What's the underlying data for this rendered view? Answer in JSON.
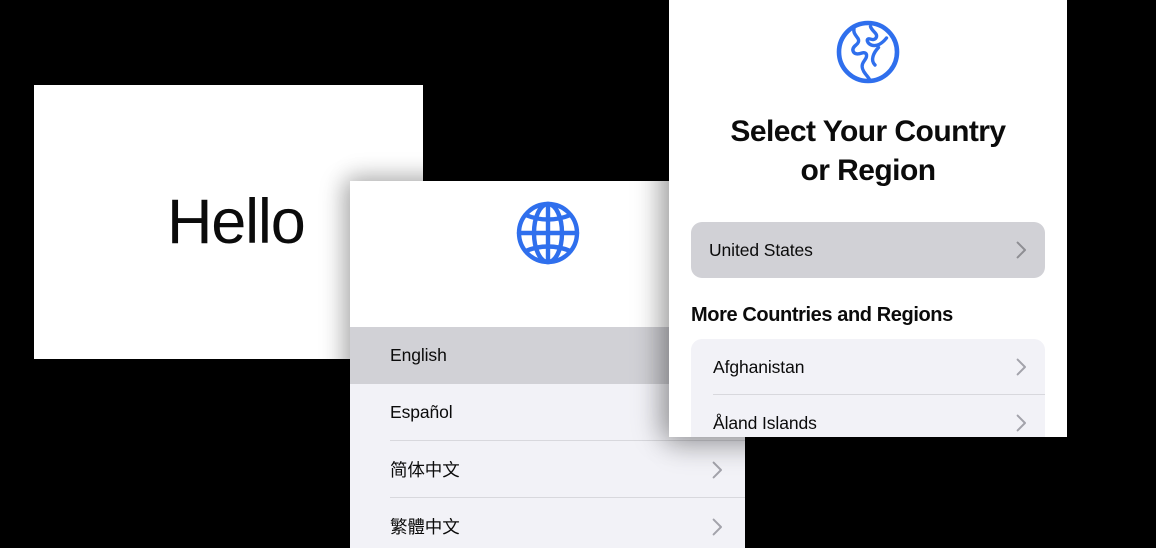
{
  "background_color": "#000000",
  "accent_color": "#2f6fed",
  "panels": {
    "hello": {
      "name": "welcome-panel",
      "greeting": "Hello"
    },
    "language": {
      "name": "language-selection-panel",
      "icon": "globe-wireframe-icon",
      "rows": [
        {
          "label": "English",
          "selected": true,
          "chevron": false
        },
        {
          "label": "Español",
          "selected": false,
          "chevron": false
        },
        {
          "label": "简体中文",
          "selected": false,
          "chevron": true
        },
        {
          "label": "繁體中文",
          "selected": false,
          "chevron": true
        }
      ]
    },
    "country": {
      "name": "country-selection-panel",
      "icon": "globe-americas-icon",
      "title": "Select Your Country or Region",
      "title_line_1": "Select Your Country",
      "title_line_2": "or Region",
      "selected_country": "United States",
      "more_heading": "More Countries and Regions",
      "rows": [
        {
          "label": "Afghanistan",
          "chevron": true
        },
        {
          "label": "Åland Islands",
          "chevron": true
        }
      ]
    }
  }
}
